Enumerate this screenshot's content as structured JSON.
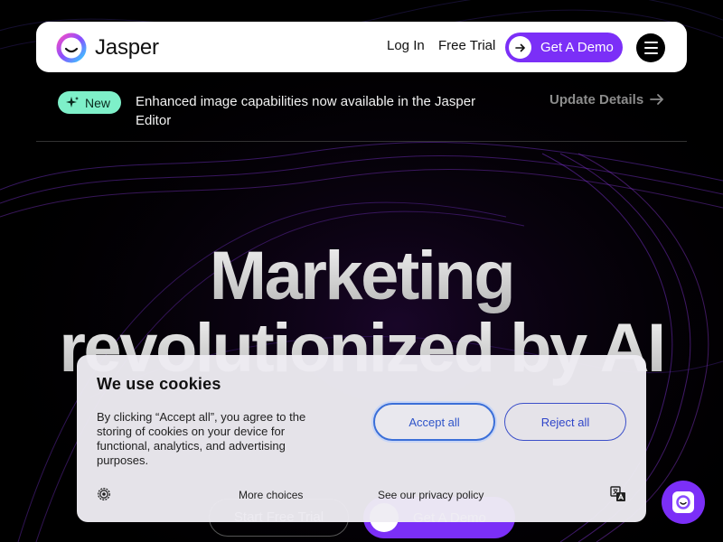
{
  "header": {
    "logo_text": "Jasper",
    "login_label": "Log In",
    "trial_label": "Free Trial",
    "demo_label": "Get A Demo"
  },
  "announcement": {
    "badge": "New",
    "text": "Enhanced image capabilities now available in the Jasper Editor",
    "link": "Update Details"
  },
  "hero": {
    "line1": "Marketing",
    "line2": "revolutionized by AI",
    "cta_trial": "Start Free Trial",
    "cta_demo": "Get A Demo"
  },
  "cookie": {
    "title": "We use cookies",
    "description": "By clicking “Accept all”, you agree to the storing of cookies on your device for functional, analytics, and advertising purposes.",
    "accept_label": "Accept all",
    "reject_label": "Reject all",
    "more_label": "More choices",
    "privacy_label": "See our privacy policy"
  },
  "colors": {
    "accent": "#7b2ff7",
    "badge": "#7ef0c9",
    "background": "#000000"
  },
  "icons": [
    "jasper-logo-icon",
    "arrow-right-icon",
    "menu-icon",
    "sparkle-icon",
    "settings-icon",
    "translate-icon",
    "chat-icon"
  ]
}
